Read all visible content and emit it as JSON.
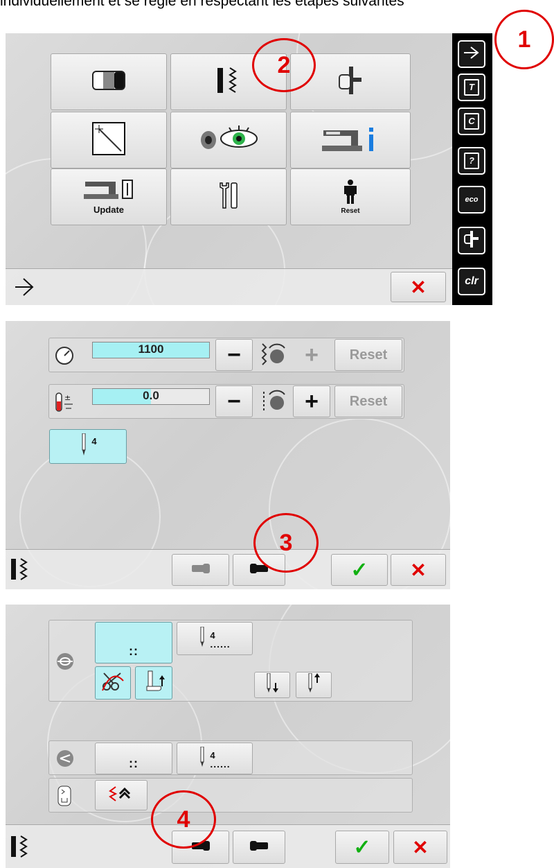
{
  "intro_text": "individuellement et se règle en respectant les étapes suivantes",
  "callouts": [
    "1",
    "2",
    "3",
    "4"
  ],
  "panel1": {
    "menu_icons": [
      "display-settings-icon",
      "stitch-settings-icon",
      "presser-foot-icon",
      "calibration-icon",
      "sound-visibility-icon",
      "machine-info-icon",
      "update-icon",
      "service-tools-icon",
      "reset-icon"
    ],
    "update_label": "Update",
    "reset_label": "Reset",
    "sidebar_icons": [
      "setup-icon",
      "tutorial-icon",
      "creative-consultant-icon",
      "help-icon",
      "eco-icon",
      "bsr-icon",
      "clr-icon"
    ],
    "sidebar_letters": [
      "T",
      "C",
      "?"
    ],
    "eco_label": "eco",
    "clr_label": "clr"
  },
  "panel2": {
    "speed_value": "1100",
    "speed_fill": 1.0,
    "tension_value": "0.0",
    "tension_fill": 0.5,
    "reset_label": "Reset",
    "minus": "−",
    "plus": "+",
    "needle_count": "4"
  },
  "panel3": {
    "stitch_count_1": "4",
    "stitch_count_2": "4",
    "dots_short": "::",
    "dots_long": "......"
  },
  "colors": {
    "accent_red": "#e00000",
    "confirm_green": "#11b011",
    "selected_cyan": "#b8f1f4"
  }
}
